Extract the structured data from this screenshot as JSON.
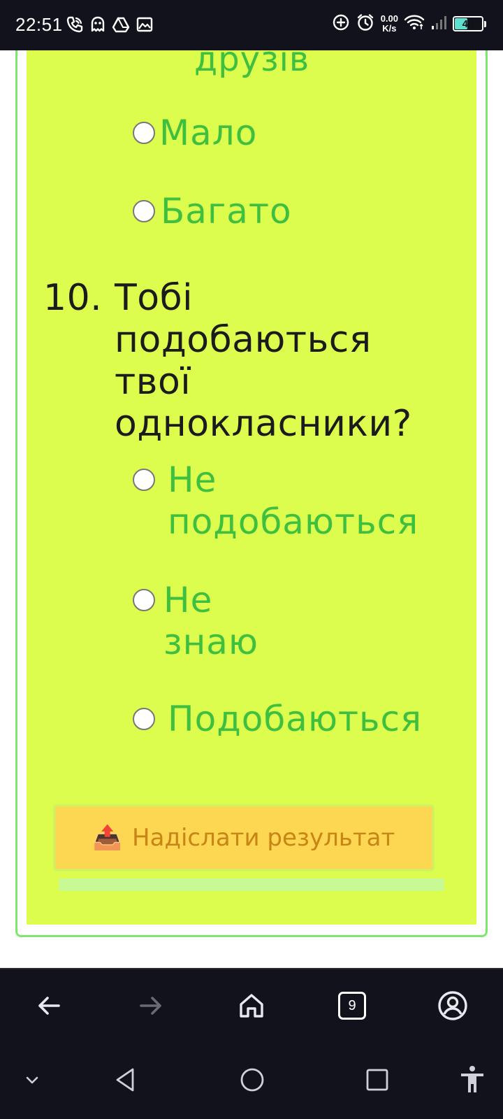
{
  "status_bar": {
    "time": "22:51",
    "net_speed_value": "0.00",
    "net_speed_unit": "K/s",
    "battery_level": "44",
    "icons": [
      "phone-call-icon",
      "ghost-icon",
      "drive-icon",
      "gallery-icon",
      "data-saver-icon",
      "alarm-icon",
      "wifi-icon",
      "signal-icon",
      "battery-icon"
    ]
  },
  "quiz": {
    "question9_tail": "друзів",
    "question9_options": [
      {
        "label": "Мало"
      },
      {
        "label": "Багато"
      }
    ],
    "question10": {
      "number": "10.",
      "text": "Тобі подобаються твої однокласники?",
      "options": [
        {
          "label": "Не подобаються"
        },
        {
          "label": "Не знаю"
        },
        {
          "label": "Подобаються"
        }
      ]
    },
    "submit": {
      "icon": "📤",
      "label": "Надіслати результат"
    }
  },
  "colors": {
    "card_background": "#dcfd4d",
    "card_border": "#7ce86c",
    "option_text": "#3fbf3f",
    "question_text": "#1b1b1b",
    "submit_background": "#fdd652",
    "submit_text": "#c88414",
    "system_bar": "#12121c"
  },
  "browser_toolbar": {
    "tab_count": "9",
    "icons": [
      "back-arrow-icon",
      "forward-arrow-icon",
      "home-icon",
      "tab-switcher-icon",
      "account-icon"
    ]
  },
  "nav_bar": {
    "icons": [
      "collapse-chevron-icon",
      "back-triangle-icon",
      "home-circle-icon",
      "recents-square-icon",
      "accessibility-icon"
    ]
  }
}
